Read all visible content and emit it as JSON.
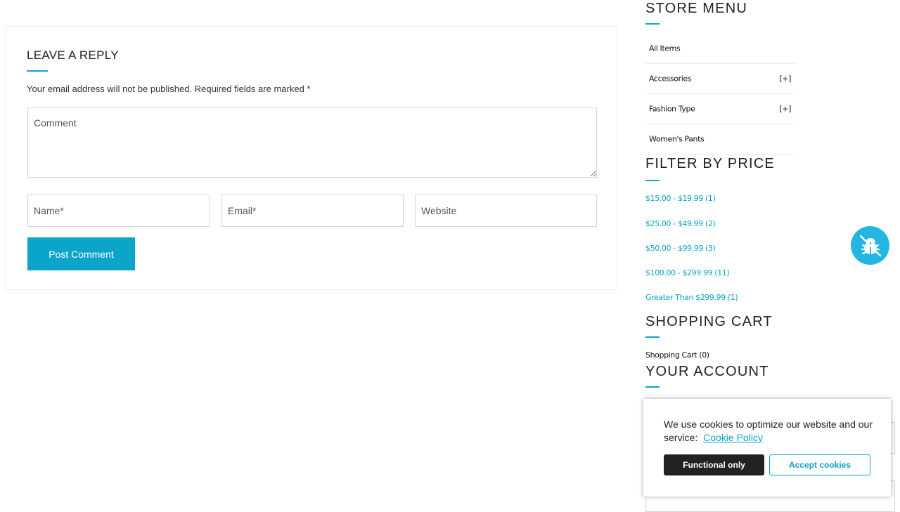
{
  "reply": {
    "title": "LEAVE A REPLY",
    "note": "Your email address will not be published. Required fields are marked *",
    "comment_placeholder": "Comment",
    "name_placeholder": "Name*",
    "email_placeholder": "Email*",
    "website_placeholder": "Website",
    "post_label": "Post Comment"
  },
  "store_menu": {
    "title": "STORE MENU",
    "items": [
      {
        "label": "All Items",
        "expander": ""
      },
      {
        "label": "Accessories",
        "expander": "[+]"
      },
      {
        "label": "Fashion Type",
        "expander": "[+]"
      },
      {
        "label": "Women's Pants",
        "expander": ""
      }
    ]
  },
  "price_filter": {
    "title": "FILTER BY PRICE",
    "ranges": [
      "$15.00 - $19.99 (1)",
      "$25.00 - $49.99 (2)",
      "$50.00 - $99.99 (3)",
      "$100.00 - $299.99 (11)",
      "Greater Than $299.99 (1)"
    ]
  },
  "cart": {
    "title": "SHOPPING CART",
    "label": "Shopping Cart (0)"
  },
  "account": {
    "title": "YOUR ACCOUNT"
  },
  "cookie": {
    "text": "We use cookies to optimize our website and our service:",
    "policy_link": "Cookie Policy",
    "functional_label": "Functional only",
    "accept_label": "Accept cookies"
  },
  "colors": {
    "accent": "#0aa5c9",
    "bug_button": "#23b5e3",
    "dark_button": "#222222"
  },
  "icons": {
    "floating_button": "bug-icon"
  }
}
